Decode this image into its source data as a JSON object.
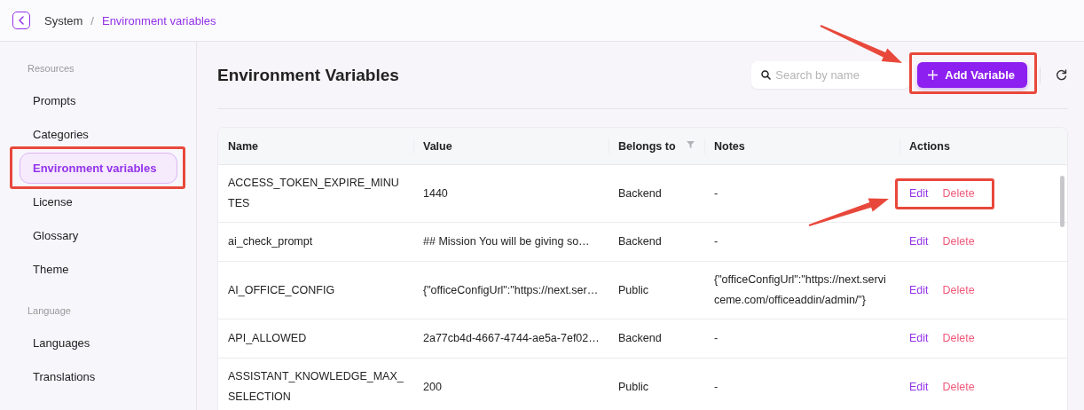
{
  "breadcrumb": {
    "separator": "/",
    "items": [
      {
        "label": "System",
        "current": false
      },
      {
        "label": "Environment variables",
        "current": true
      }
    ]
  },
  "sidebar": {
    "sections": [
      {
        "heading": "Resources",
        "items": [
          {
            "label": "Prompts",
            "selected": false,
            "highlighted": false
          },
          {
            "label": "Categories",
            "selected": false,
            "highlighted": false
          },
          {
            "label": "Environment variables",
            "selected": true,
            "highlighted": true
          },
          {
            "label": "License",
            "selected": false,
            "highlighted": false
          },
          {
            "label": "Glossary",
            "selected": false,
            "highlighted": false
          },
          {
            "label": "Theme",
            "selected": false,
            "highlighted": false
          }
        ]
      },
      {
        "heading": "Language",
        "items": [
          {
            "label": "Languages",
            "selected": false,
            "highlighted": false
          },
          {
            "label": "Translations",
            "selected": false,
            "highlighted": false
          }
        ]
      }
    ]
  },
  "page_title": "Environment Variables",
  "search": {
    "placeholder": "Search by name"
  },
  "add_button": {
    "label": "Add Variable",
    "highlighted": true,
    "arrow": true
  },
  "table": {
    "columns": [
      {
        "label": "Name",
        "filter": false
      },
      {
        "label": "Value",
        "filter": false
      },
      {
        "label": "Belongs to",
        "filter": true
      },
      {
        "label": "Notes",
        "filter": false
      },
      {
        "label": "Actions",
        "filter": false
      }
    ],
    "rows": [
      {
        "name": "ACCESS_TOKEN_EXPIRE_MINUTES",
        "value": "1440",
        "belongs_to": "Backend",
        "notes": "-",
        "actions": [
          {
            "label": "Edit",
            "kind": "edit"
          },
          {
            "label": "Delete",
            "kind": "delete"
          }
        ],
        "highlighted": true,
        "arrow": true
      },
      {
        "name": "ai_check_prompt",
        "value": "## Mission You will be giving so…",
        "belongs_to": "Backend",
        "notes": "-",
        "actions": [
          {
            "label": "Edit",
            "kind": "edit"
          },
          {
            "label": "Delete",
            "kind": "delete"
          }
        ],
        "highlighted": false,
        "arrow": false
      },
      {
        "name": "AI_OFFICE_CONFIG",
        "value": "{\"officeConfigUrl\":\"https://next.ser…",
        "belongs_to": "Public",
        "notes": "{\"officeConfigUrl\":\"https://next.serviceme.com/officeaddin/admin/\"}",
        "actions": [
          {
            "label": "Edit",
            "kind": "edit"
          },
          {
            "label": "Delete",
            "kind": "delete"
          }
        ],
        "highlighted": false,
        "arrow": false
      },
      {
        "name": "API_ALLOWED",
        "value": "2a77cb4d-4667-4744-ae5a-7ef02…",
        "belongs_to": "Backend",
        "notes": "-",
        "actions": [
          {
            "label": "Edit",
            "kind": "edit"
          },
          {
            "label": "Delete",
            "kind": "delete"
          }
        ],
        "highlighted": false,
        "arrow": false
      },
      {
        "name": "ASSISTANT_KNOWLEDGE_MAX_SELECTION",
        "value": "200",
        "belongs_to": "Public",
        "notes": "-",
        "actions": [
          {
            "label": "Edit",
            "kind": "edit"
          },
          {
            "label": "Delete",
            "kind": "delete"
          }
        ],
        "highlighted": false,
        "arrow": false
      }
    ]
  }
}
